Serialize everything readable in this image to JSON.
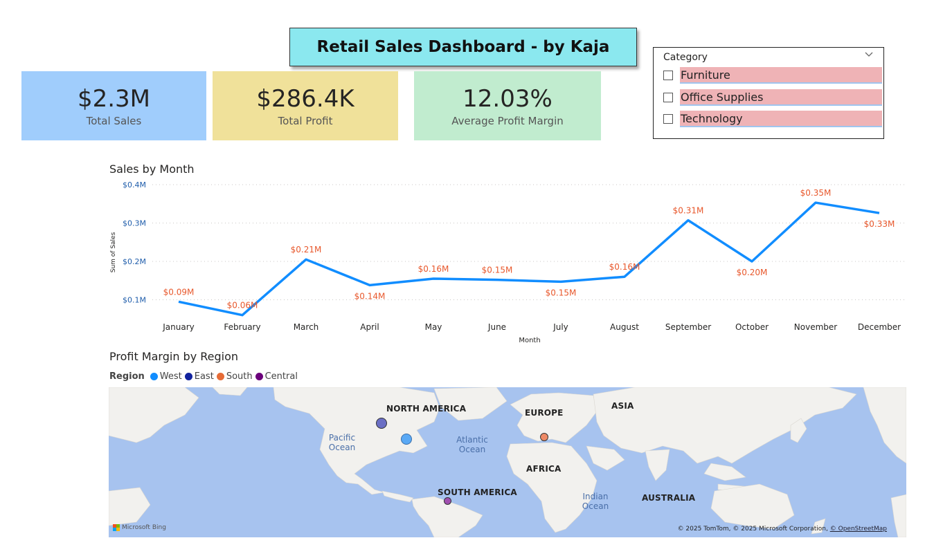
{
  "title": "Retail Sales Dashboard - by Kaja",
  "kpis": [
    {
      "value": "$2.3M",
      "label": "Total Sales",
      "color": "#a0cdfc"
    },
    {
      "value": "$286.4K",
      "label": "Total Profit",
      "color": "#f0e19a"
    },
    {
      "value": "12.03%",
      "label": "Average Profit Margin",
      "color": "#c1eccf"
    }
  ],
  "slicer": {
    "title": "Category",
    "items": [
      "Furniture",
      "Office Supplies",
      "Technology"
    ]
  },
  "sales_chart": {
    "title": "Sales by Month"
  },
  "chart_data": {
    "type": "line",
    "title": "Sales by Month",
    "xlabel": "Month",
    "ylabel": "Sum of Sales",
    "categories": [
      "January",
      "February",
      "March",
      "April",
      "May",
      "June",
      "July",
      "August",
      "September",
      "October",
      "November",
      "December"
    ],
    "values": [
      0.095,
      0.06,
      0.205,
      0.138,
      0.155,
      0.152,
      0.147,
      0.16,
      0.307,
      0.2,
      0.353,
      0.326
    ],
    "data_labels": [
      "$0.09M",
      "$0.06M",
      "$0.21M",
      "$0.14M",
      "$0.16M",
      "$0.15M",
      "$0.15M",
      "$0.16M",
      "$0.31M",
      "$0.20M",
      "$0.35M",
      "$0.33M"
    ],
    "label_position": [
      "above",
      "above",
      "above",
      "below",
      "above",
      "above",
      "below",
      "above",
      "above",
      "below",
      "above",
      "below"
    ],
    "yticks": [
      0.1,
      0.2,
      0.3,
      0.4
    ],
    "ytick_labels": [
      "$0.1M",
      "$0.2M",
      "$0.3M",
      "$0.4M"
    ],
    "ylim": [
      0.0,
      0.4
    ],
    "grid": true,
    "line_color": "#118dff",
    "label_color": "#e8582c",
    "tick_color": "#1f5dab"
  },
  "map": {
    "title": "Profit Margin by Region",
    "legend_title": "Region",
    "regions": [
      {
        "name": "West",
        "color": "#118dff"
      },
      {
        "name": "East",
        "color": "#12239e"
      },
      {
        "name": "South",
        "color": "#e66c37"
      },
      {
        "name": "Central",
        "color": "#6b007b"
      }
    ],
    "continents": [
      "NORTH AMERICA",
      "EUROPE",
      "ASIA",
      "AFRICA",
      "SOUTH AMERICA",
      "AUSTRALIA"
    ],
    "oceans": [
      "Pacific Ocean",
      "Atlantic Ocean",
      "Indian Ocean"
    ],
    "bing": "Microsoft Bing",
    "attribution": "© 2025 TomTom, © 2025 Microsoft Corporation,",
    "attribution_link": "© OpenStreetMap"
  }
}
